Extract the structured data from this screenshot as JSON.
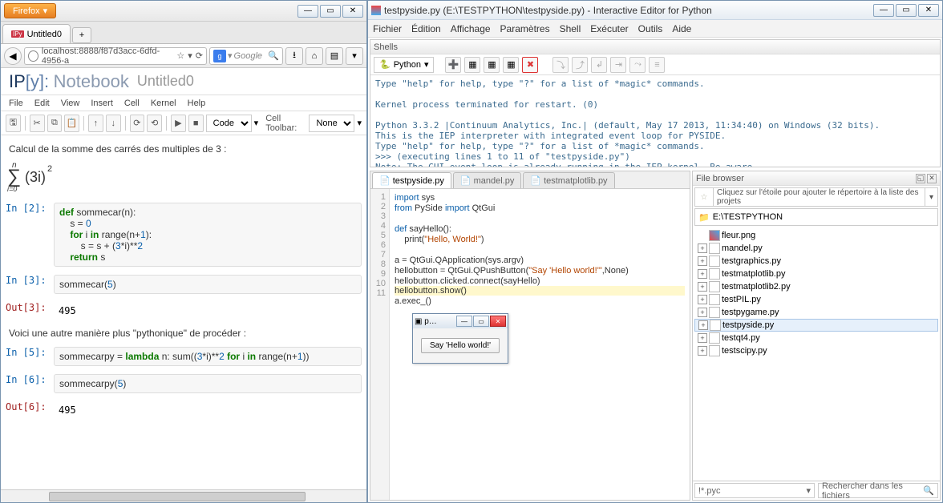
{
  "firefox": {
    "brand": "Firefox",
    "winbtns": {
      "min": "—",
      "max": "▭",
      "close": "✕"
    },
    "tab": {
      "label": "Untitled0",
      "ipy": "IPy"
    },
    "newtab": "+",
    "url": "localhost:8888/f87d3acc-6dfd-4956-a",
    "star": "☆",
    "reload": "⟳",
    "google_btn": "g",
    "google_dd": "▾",
    "google_ph": "Google",
    "search": "🔍",
    "dl": "⭳",
    "home": "⌂",
    "bm": "▤",
    "more": "▾"
  },
  "notebook": {
    "logo_prefix": "IP",
    "logo_y": "[y]:",
    "logo_word": "Notebook",
    "title": "Untitled0",
    "menu": [
      "File",
      "Edit",
      "View",
      "Insert",
      "Cell",
      "Kernel",
      "Help"
    ],
    "toolbar": {
      "save": "🖫",
      "cut": "✂",
      "copy": "⧉",
      "paste": "📋",
      "up": "↑",
      "down": "↓",
      "th1": "⟳",
      "th2": "⟲",
      "run": "▶",
      "stop": "■"
    },
    "format_label": "Code",
    "cell_toolbar_label": "Cell Toolbar:",
    "cell_toolbar_sel": "None",
    "md1": "Calcul de la somme des carrés des multiples de 3 :",
    "math_sum": "∑",
    "math_top": "n",
    "math_bot": "i=0",
    "math_body": "(3i)",
    "math_exp": "2",
    "in2": "In [2]: ",
    "code2": {
      "l1a": "def",
      "l1b": " sommecar(n):",
      "l2a": "    s = ",
      "l2b": "0",
      "l3a": "    ",
      "l3b": "for",
      "l3c": " i ",
      "l3d": "in",
      "l3e": " range(n+",
      "l3f": "1",
      "l3g": "):",
      "l4a": "        s = s + (",
      "l4b": "3",
      "l4c": "*i)**",
      "l4d": "2",
      "l5a": "    ",
      "l5b": "return",
      "l5c": " s"
    },
    "in3": "In [3]: ",
    "code3": "sommecar(",
    "code3n": "5",
    "code3e": ")",
    "out3": "Out[3]: ",
    "val3": "495",
    "md2": "Voici une autre manière plus \"pythonique\" de procéder :",
    "in5": "In [5]: ",
    "code5a": "sommecarpy = ",
    "code5b": "lambda",
    "code5c": " n: sum((",
    "code5d": "3",
    "code5e": "*i)**",
    "code5f": "2",
    "code5g": " ",
    "code5h": "for",
    "code5i": " i ",
    "code5j": "in",
    "code5k": " range(n+",
    "code5l": "1",
    "code5m": "))",
    "in6": "In [6]: ",
    "code6": "sommecarpy(",
    "code6n": "5",
    "code6e": ")",
    "out6": "Out[6]: ",
    "val6": "495"
  },
  "iep": {
    "title": "testpyside.py (E:\\TESTPYTHON\\testpyside.py) - Interactive Editor for Python",
    "menu": [
      "Fichier",
      "Édition",
      "Affichage",
      "Paramètres",
      "Shell",
      "Exécuter",
      "Outils",
      "Aide"
    ],
    "shell_title": "Shells",
    "python_label": "Python",
    "shell_output": "Type \"help\" for help, type \"?\" for a list of *magic* commands.\n\nKernel process terminated for restart. (0)\n\nPython 3.3.2 |Continuum Analytics, Inc.| (default, May 17 2013, 11:34:40) on Windows (32 bits).\nThis is the IEP interpreter with integrated event loop for PYSIDE.\nType \"help\" for help, type \"?\" for a list of *magic* commands.\n>>> (executing lines 1 to 11 of \"testpyside.py\")\nNote: The GUI event loop is already running in the IEP kernel. Be aware\nthat the function to enter the main loop does not block.>>> ",
    "tabs": [
      "testpyside.py",
      "mandel.py",
      "testmatplotlib.py"
    ],
    "gutter": [
      "1",
      "2",
      "3",
      "4",
      "5",
      "6",
      "7",
      "8",
      "9",
      "10",
      "11"
    ],
    "code": {
      "l1a": "import",
      "l1b": " sys",
      "l2a": "from",
      "l2b": " PySide ",
      "l2c": "import",
      "l2d": " QtGui",
      "l4a": "def",
      "l4b": " sayHello():",
      "l5a": "    print(",
      "l5b": "\"Hello, World!\"",
      "l5c": ")",
      "l7": "a = QtGui.QApplication(sys.argv)",
      "l8a": "hellobutton = QtGui.QPushButton(",
      "l8b": "\"Say 'Hello world!'\"",
      "l8c": ",None)",
      "l9": "hellobutton.clicked.connect(sayHello)",
      "l10": "hellobutton.show()",
      "l11": "a.exec_()"
    },
    "mini": {
      "title": "p…",
      "btn": "Say 'Hello world!'"
    },
    "fb_title": "File browser",
    "fb_hint": "Cliquez sur l'étoile pour ajouter le répertoire à la liste des projets",
    "fb_path": "E:\\TESTPYTHON",
    "files": [
      "fleur.png",
      "mandel.py",
      "testgraphics.py",
      "testmatplotlib.py",
      "testmatplotlib2.py",
      "testPIL.py",
      "testpygame.py",
      "testpyside.py",
      "testqt4.py",
      "testscipy.py"
    ],
    "filter": "!*.pyc",
    "search_ph": "Rechercher dans les fichiers"
  }
}
